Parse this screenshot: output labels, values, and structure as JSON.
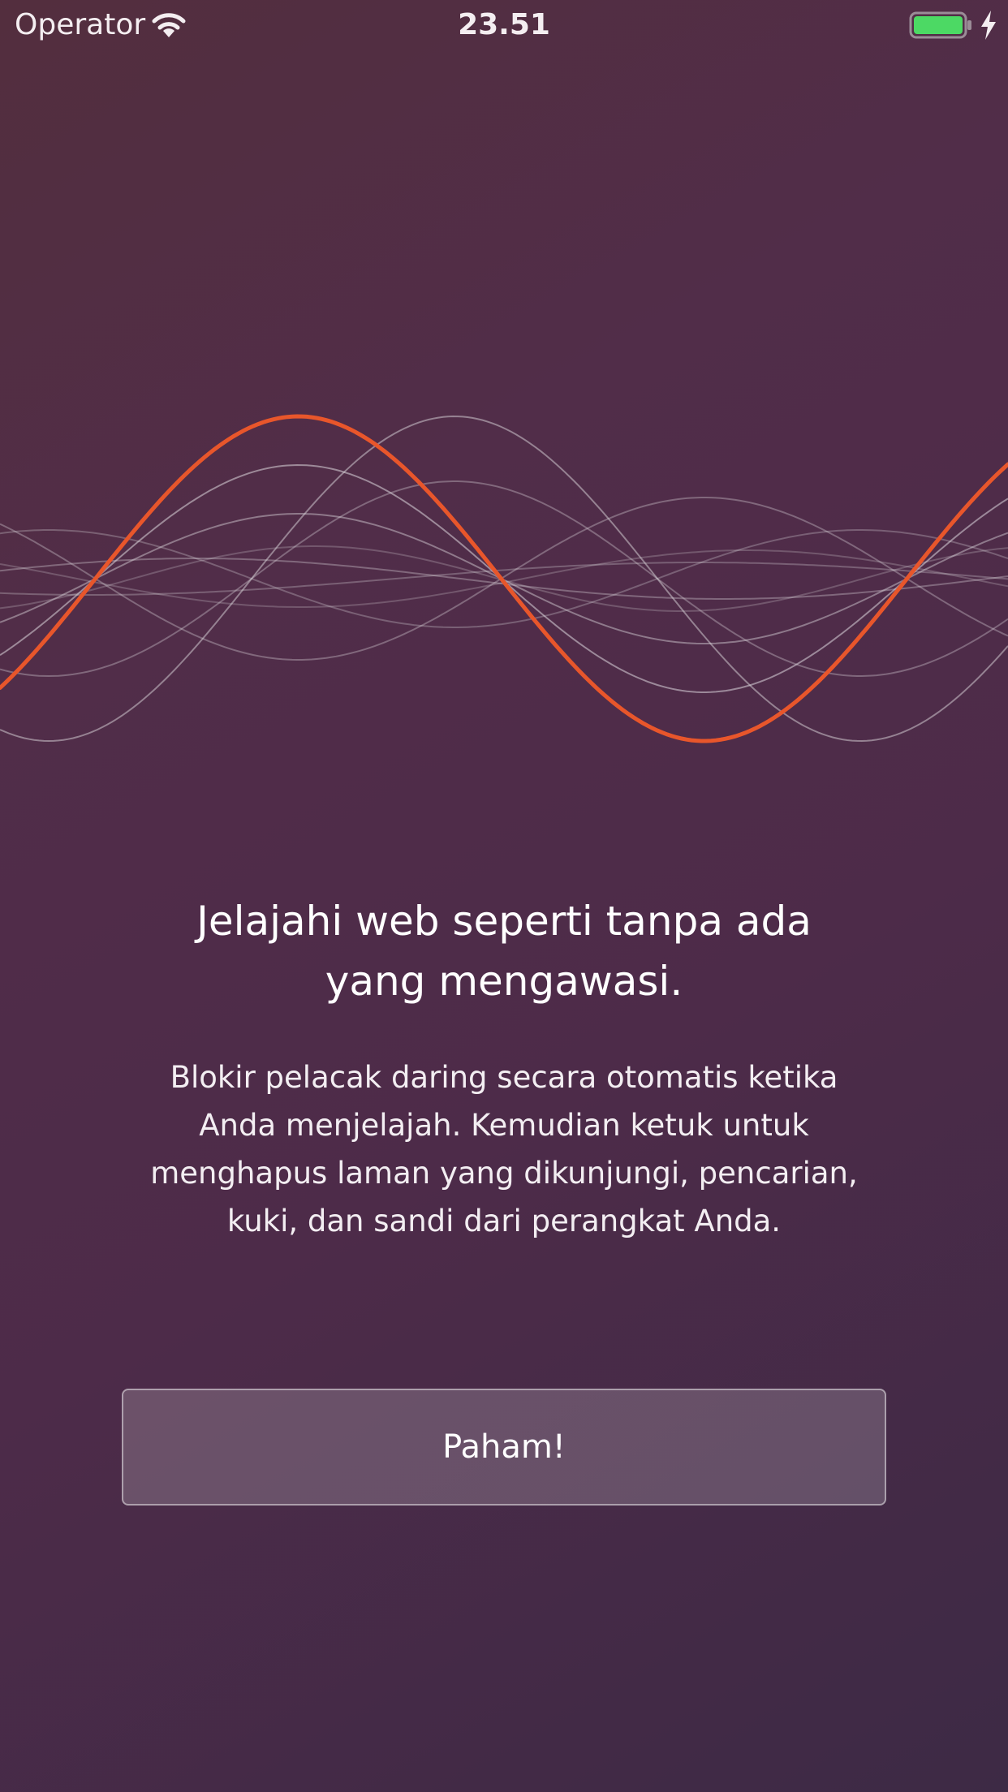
{
  "status_bar": {
    "carrier": "Operator",
    "time": "23.51",
    "icons": [
      "wifi-icon",
      "battery-icon",
      "charging-bolt-icon"
    ],
    "battery_level": 1.0,
    "battery_color": "#4cd964"
  },
  "onboarding": {
    "headline_line1": "Jelajahi web seperti tanpa ada",
    "headline_line2": "yang mengawasi.",
    "body_lines": [
      "Blokir pelacak daring secara otomatis ketika",
      "Anda menjelajah. Kemudian ketuk untuk",
      "menghapus laman yang dikunjungi, pencarian,",
      "kuki, dan sandi dari perangkat Anda."
    ],
    "button_label": "Paham!"
  },
  "illustration": {
    "icon": "sound-wave-illustration",
    "accent_color": "#e8562b"
  },
  "colors": {
    "background_start": "#532e3e",
    "background_end": "#3d2a45",
    "text": "#ffffff"
  }
}
